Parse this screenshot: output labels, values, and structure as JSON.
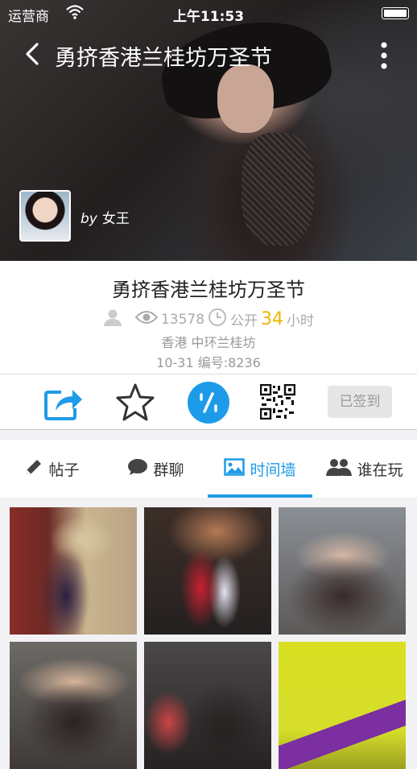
{
  "status_bar": {
    "carrier": "运营商",
    "time": "上午11:53"
  },
  "nav": {
    "title": "勇挤香港兰桂坊万圣节"
  },
  "author": {
    "by": "by",
    "name": "女王"
  },
  "event": {
    "title": "勇挤香港兰桂坊万圣节",
    "views": "13578",
    "public_label": "公开",
    "hours": "34",
    "hours_unit": "小时",
    "location": "香港 中环兰桂坊",
    "date_code": "10-31 编号:8236"
  },
  "actions": {
    "checkin_label": "已签到"
  },
  "tabs": [
    {
      "label": "帖子",
      "icon": "pencil-icon"
    },
    {
      "label": "群聊",
      "icon": "chat-bubble-icon"
    },
    {
      "label": "时间墙",
      "icon": "image-icon",
      "active": true
    },
    {
      "label": "谁在玩",
      "icon": "people-icon"
    }
  ],
  "colors": {
    "accent": "#1e9be8",
    "highlight": "#f0b400",
    "checkin_bg": "#e6e6e6"
  }
}
